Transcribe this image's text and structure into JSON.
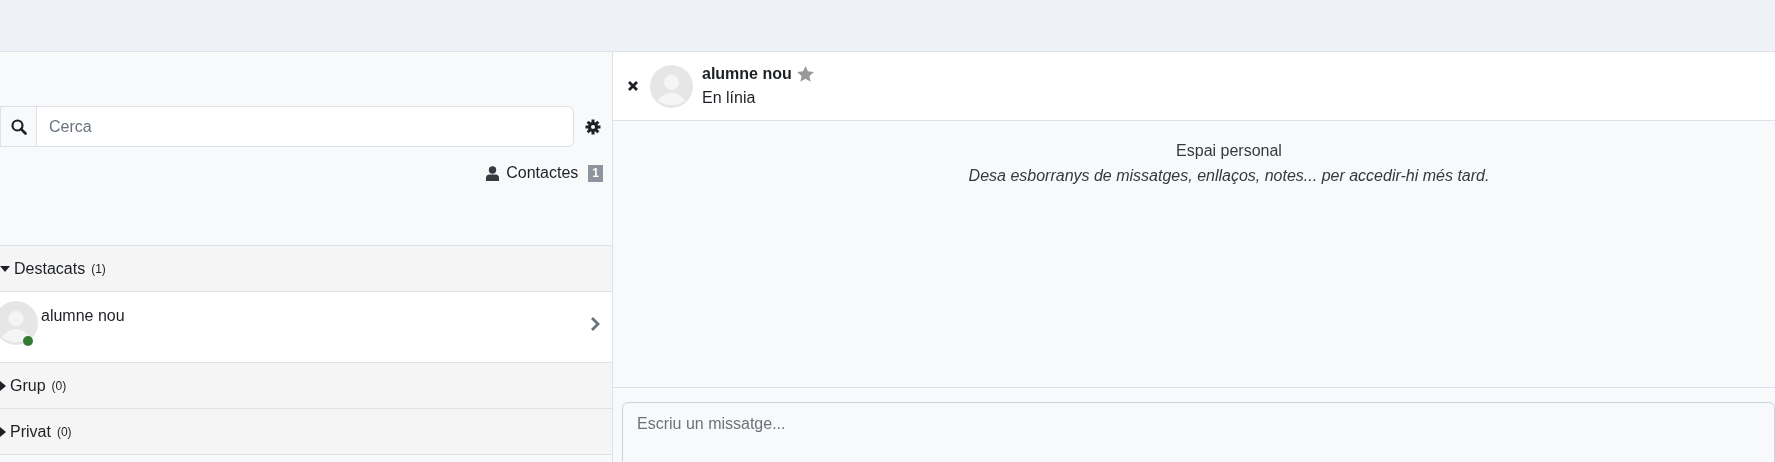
{
  "search": {
    "placeholder": "Cerca"
  },
  "contacts_link": {
    "label": "Contactes",
    "count": "1"
  },
  "sections": [
    {
      "title": "Destacats",
      "count": "(1)",
      "expanded": true,
      "items": [
        {
          "name": "alumne nou",
          "online": true
        }
      ]
    },
    {
      "title": "Grup",
      "count": "(0)",
      "expanded": false
    },
    {
      "title": "Privat",
      "count": "(0)",
      "expanded": false
    }
  ],
  "conversation": {
    "name": "alumne nou",
    "status": "En línia",
    "empty_title": "Espai personal",
    "empty_text": "Desa esborranys de missatges, enllaços, notes... per accedir-hi més tard."
  },
  "composer": {
    "placeholder": "Escriu un missatge..."
  }
}
